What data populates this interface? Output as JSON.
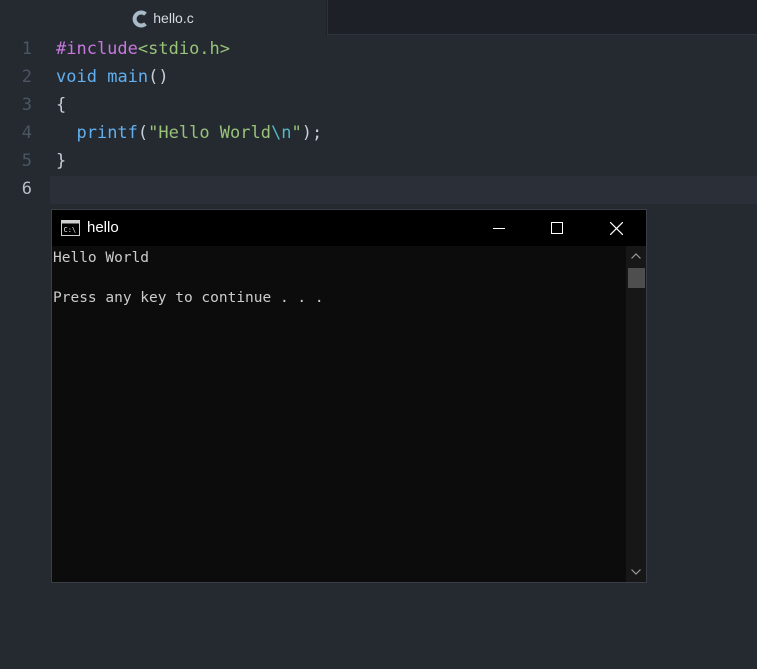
{
  "editor": {
    "tab": {
      "label": "hello.c",
      "icon": "c-language-icon",
      "icon_color": "#a8b9c7"
    },
    "line_numbers": [
      "1",
      "2",
      "3",
      "4",
      "5",
      "6"
    ],
    "current_line": "6",
    "code": {
      "l1": {
        "directive": "#include",
        "header": "<stdio.h>"
      },
      "l2": {
        "type": "void",
        "space": " ",
        "fn": "main",
        "parens": "()"
      },
      "l3": {
        "text": "{"
      },
      "l4": {
        "indent": "  ",
        "fn": "printf",
        "open": "(",
        "str1": "\"Hello World",
        "esc": "\\n",
        "str2": "\"",
        "close": ");"
      },
      "l5": {
        "text": "}"
      }
    },
    "colors": {
      "background": "#252a31",
      "keyword": "#c678dd",
      "function": "#61afef",
      "string": "#98c379",
      "escape": "#56b6c2"
    }
  },
  "console": {
    "title": "hello",
    "icon": "console-icon",
    "buttons": {
      "minimize": "minimize-icon",
      "maximize": "maximize-icon",
      "close": "close-icon"
    },
    "output": [
      "Hello World",
      "",
      "Press any key to continue . . ."
    ]
  }
}
